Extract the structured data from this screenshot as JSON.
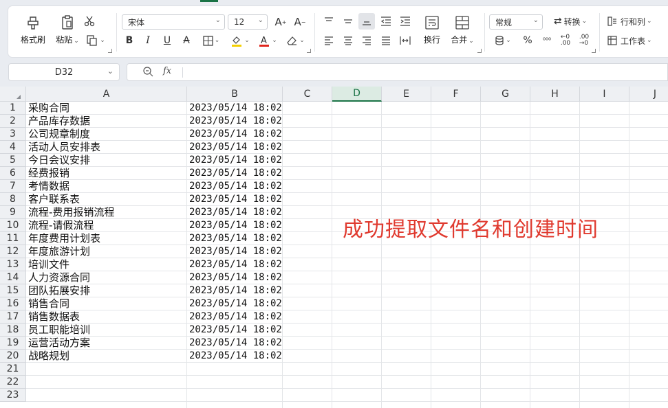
{
  "ribbon": {
    "format_painter": "格式刷",
    "paste": "粘贴",
    "font_name": "宋体",
    "font_size": "12",
    "wrap": "换行",
    "merge": "合并",
    "number_format": "常规",
    "convert": "转换",
    "rows_cols": "行和列",
    "worksheet": "工作表",
    "percent": "%"
  },
  "formula_bar": {
    "name_box": "D32",
    "fx": "fx",
    "value": ""
  },
  "columns": [
    "A",
    "B",
    "C",
    "D",
    "E",
    "F",
    "G",
    "H",
    "I",
    "J"
  ],
  "rows": [
    "1",
    "2",
    "3",
    "4",
    "5",
    "6",
    "7",
    "8",
    "9",
    "10",
    "11",
    "12",
    "13",
    "14",
    "15",
    "16",
    "17",
    "18",
    "19",
    "20",
    "21",
    "22",
    "23"
  ],
  "data": [
    {
      "a": "采购合同",
      "b": "2023/05/14 18:02:"
    },
    {
      "a": "产品库存数据",
      "b": "2023/05/14 18:02:"
    },
    {
      "a": "公司规章制度",
      "b": "2023/05/14 18:02:"
    },
    {
      "a": "活动人员安排表",
      "b": "2023/05/14 18:02:"
    },
    {
      "a": "今日会议安排",
      "b": "2023/05/14 18:02:"
    },
    {
      "a": "经费报销",
      "b": "2023/05/14 18:02:"
    },
    {
      "a": "考情数据",
      "b": "2023/05/14 18:02:"
    },
    {
      "a": "客户联系表",
      "b": "2023/05/14 18:02:"
    },
    {
      "a": "流程-费用报销流程",
      "b": "2023/05/14 18:02:"
    },
    {
      "a": "流程-请假流程",
      "b": "2023/05/14 18:02:"
    },
    {
      "a": "年度费用计划表",
      "b": "2023/05/14 18:02:"
    },
    {
      "a": "年度旅游计划",
      "b": "2023/05/14 18:02:"
    },
    {
      "a": "培训文件",
      "b": "2023/05/14 18:02:"
    },
    {
      "a": "人力资源合同",
      "b": "2023/05/14 18:02:"
    },
    {
      "a": "团队拓展安排",
      "b": "2023/05/14 18:02:"
    },
    {
      "a": "销售合同",
      "b": "2023/05/14 18:02:"
    },
    {
      "a": "销售数据表",
      "b": "2023/05/14 18:02:"
    },
    {
      "a": "员工职能培训",
      "b": "2023/05/14 18:02:"
    },
    {
      "a": "运营活动方案",
      "b": "2023/05/14 18:02:"
    },
    {
      "a": "战略规划",
      "b": "2023/05/14 18:02:"
    }
  ],
  "annotation": "成功提取文件名和创建时间",
  "colors": {
    "accent": "#1a7346",
    "annotation": "#e03a2f",
    "font_underline_yellow": "#f5d000",
    "font_color_red": "#e0261d"
  }
}
